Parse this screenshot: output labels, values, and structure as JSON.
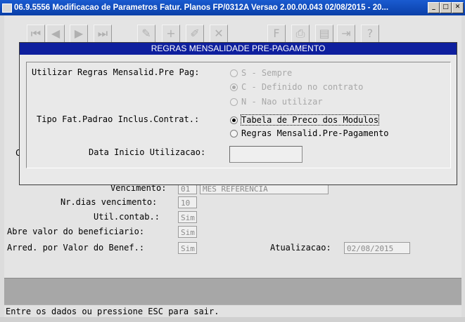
{
  "window": {
    "title": "06.9.5556 Modificacao  de Parametros Fatur. Planos FP/0312A Versao 2.00.00.043 02/08/2015 - 20...",
    "minimize_glyph": "_",
    "maximize_glyph": "□",
    "close_glyph": "✕"
  },
  "toolbar": {
    "icons": [
      "first-record-icon",
      "prev-record-icon",
      "next-record-icon",
      "last-record-icon",
      "goto-icon",
      "add-icon",
      "edit-icon",
      "delete-icon",
      "filter-icon",
      "print-icon",
      "copy-icon",
      "exit-icon",
      "help-icon"
    ]
  },
  "background_form": {
    "vencimento_label": "Vencimento:",
    "vencimento_code": "01",
    "vencimento_desc": "MES REFERENCIA",
    "nr_dias_label": "Nr.dias vencimento:",
    "nr_dias_value": "10",
    "util_contab_label": "Util.contab.:",
    "util_contab_value": "Sim",
    "abre_valor_label": "Abre valor do beneficiario:",
    "abre_valor_value": "Sim",
    "arred_label": "Arred. por Valor do Benef.:",
    "arred_value": "Sim",
    "atualizacao_label": "Atualizacao:",
    "atualizacao_value": "02/08/2015",
    "partial_label": "C"
  },
  "dialog": {
    "title": "REGRAS MENSALIDADE PRE-PAGAMENTO",
    "utilizar_label": "Utilizar Regras Mensalid.Pre Pag:",
    "utilizar_options": [
      {
        "label": "S - Sempre",
        "selected": false
      },
      {
        "label": "C - Definido no contrato",
        "selected": true
      },
      {
        "label": "N - Nao utilizar",
        "selected": false
      }
    ],
    "tipo_fat_label": "Tipo Fat.Padrao Inclus.Contrat.:",
    "tipo_fat_options": [
      {
        "label": "Tabela de Preco dos Modulos",
        "selected": true
      },
      {
        "label": "Regras Mensalid.Pre-Pagamento",
        "selected": false
      }
    ],
    "data_inicio_label": "Data Inicio Utilizacao:",
    "data_inicio_value": ""
  },
  "status": {
    "message": "Entre os dados ou pressione ESC para sair."
  }
}
